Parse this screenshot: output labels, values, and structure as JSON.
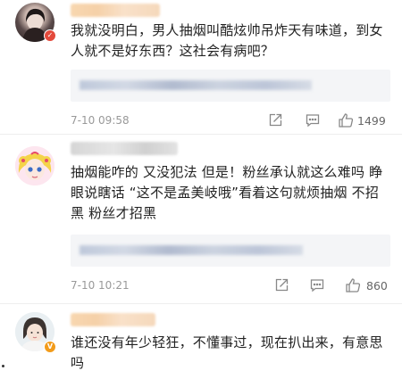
{
  "comments": [
    {
      "text": "我就没明白，男人抽烟叫酷炫帅吊炸天有味道，到女人就不是好东西？这社会有病吧？",
      "time": "7-10 09:58",
      "likes": "1499",
      "username_style": "orange"
    },
    {
      "text": "抽烟能咋的 又没犯法 但是！粉丝承认就这么难吗 睁眼说瞎话 “这不是孟美岐哦”看着这句就烦抽烟 不招黑 粉丝才招黑",
      "time": "7-10 10:21",
      "likes": "860",
      "username_style": "gray"
    },
    {
      "text": "谁还没有年少轻狂，不懂事过，现在扒出来，有意思吗",
      "username_style": "orange"
    }
  ],
  "icons": {
    "share": "share-icon",
    "comment": "comment-icon",
    "like": "thumbs-up-icon"
  },
  "colors": {
    "badge_red": "#e34a3c",
    "badge_orange": "#f29b1a",
    "meta_gray": "#999999"
  }
}
